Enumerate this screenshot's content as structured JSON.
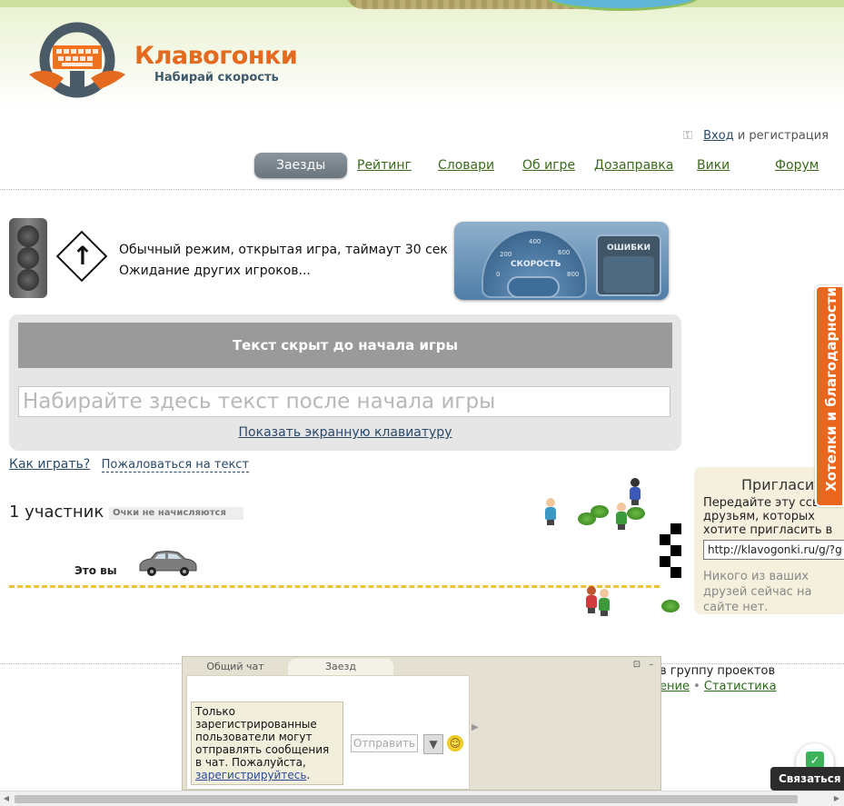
{
  "brand": {
    "name": "Клавогонки",
    "tagline": "Набирай скорость"
  },
  "auth": {
    "login_label": "Вход",
    "register_suffix": "и регистрация"
  },
  "nav": {
    "items": [
      {
        "label": "Заезды",
        "active": true
      },
      {
        "label": "Рейтинг"
      },
      {
        "label": "Словари"
      },
      {
        "label": "Об игре"
      },
      {
        "label": "Дозаправка"
      },
      {
        "label": "Вики"
      },
      {
        "label": "Форум"
      }
    ]
  },
  "game": {
    "mode_line": "Обычный режим, открытая игра, таймаут 30 сек",
    "waiting_line": "Ожидание других игроков...",
    "speedometer_label": "СКОРОСТЬ",
    "speed_ticks": [
      "0",
      "200",
      "400",
      "600",
      "800"
    ],
    "errors_label": "ОШИБКИ",
    "hidden_text": "Текст скрыт до начала игры",
    "input_placeholder": "Набирайте здесь текст после начала игры",
    "keyboard_link": "Показать экранную клавиатуру"
  },
  "help": {
    "how_to_play": "Как играть?",
    "complain": "Пожаловаться на текст"
  },
  "race": {
    "participants": "1 участник",
    "points_note": "Очки не начисляются",
    "you_label": "Это вы"
  },
  "invite": {
    "title": "Пригласит",
    "text": "Передайте эту ссыл друзьям, которых хотите пригласить в игру:",
    "link": "http://klavogonki.ru/g/?g",
    "note": "Никого из ваших друзей сейчас на сайте нет."
  },
  "feedback_tab": "Хотелки и благодарности",
  "footer": {
    "text": "в группу проектов",
    "links": [
      "ение",
      "Статистика"
    ],
    "separator": "•"
  },
  "chat": {
    "tabs": [
      "Общий чат",
      "Заезд"
    ],
    "notice_text": "Только зарегистрированные пользователи могут отправлять сообщения в чат. Пожалуйста, ",
    "notice_link": "зарегистрируйтесь",
    "notice_end": ".",
    "send_label": "Отправить"
  },
  "contact_button": "Связаться",
  "colors": {
    "brand_orange": "#e46a1f",
    "nav_link": "#3a6a1a",
    "feedback_orange": "#e8661e",
    "track_yellow": "#f0c23a"
  }
}
